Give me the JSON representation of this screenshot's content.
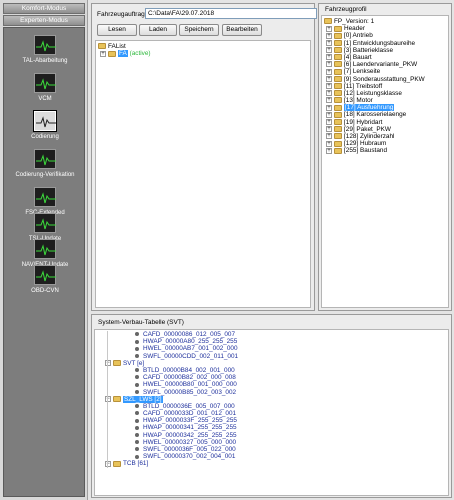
{
  "modes": {
    "komfort": "Komfort-Modus",
    "experten": "Experten-Modus"
  },
  "tools": [
    "TAL-Abarbeitung",
    "VCM",
    "Codierung",
    "Codierung-Verifikation",
    "FSC-Extended",
    "TSL-Update",
    "NAV/ENT-Update",
    "OBD-CVN"
  ],
  "auftrag": {
    "label": "Fahrzeugauftrag",
    "value": "C:\\Data\\FA\\29.07.2018",
    "buttons": [
      "Lesen",
      "Laden",
      "Speichern",
      "Bearbeiten"
    ],
    "tree_root": "FAList",
    "tree_child": "FA",
    "tree_child_suffix": "(active)"
  },
  "profil": {
    "title": "Fahrzeugprofil",
    "root": "FP_Version: 1",
    "items": [
      "Header",
      "[0] Antrieb",
      "[1] Entwicklungsbaureihe",
      "[3] Batterieklasse",
      "[4] Bauart",
      "[6] Laendervariante_PKW",
      "[7] Lenkseite",
      "[9] Sonderausstattung_PKW",
      "[11] Treibstoff",
      "[12] Leistungsklasse",
      "[13] Motor",
      "[17] Ausfuehrung",
      "[18] Karosserielaenge",
      "[19] Hybridart",
      "[29] Paket_PKW",
      "[128] Zylinderzahl",
      "[129] Hubraum",
      "[255] Baustand"
    ],
    "selected_index": 11
  },
  "svt": {
    "title": "System-Verbau-Tabelle (SVT)",
    "rows": [
      {
        "type": "leaf",
        "indent": 2,
        "text": "CAFD_00000086_012_005_007"
      },
      {
        "type": "leaf",
        "indent": 2,
        "text": "HWAP_00000A80_255_255_255"
      },
      {
        "type": "leaf",
        "indent": 2,
        "text": "HWEL_00000AB7_001_002_000"
      },
      {
        "type": "leaf",
        "indent": 2,
        "text": "SWFL_00000CDD_002_011_001"
      },
      {
        "type": "node",
        "indent": 1,
        "text": "SVT [e]"
      },
      {
        "type": "leaf",
        "indent": 2,
        "text": "BTLD_00000B84_002_001_000"
      },
      {
        "type": "leaf",
        "indent": 2,
        "text": "CAFD_00000B82_002_000_008"
      },
      {
        "type": "leaf",
        "indent": 2,
        "text": "HWEL_00000B80_001_000_000"
      },
      {
        "type": "leaf",
        "indent": 2,
        "text": "SWFL_00000B85_002_003_002"
      },
      {
        "type": "node",
        "indent": 1,
        "text": "SZL_LWS [2]",
        "selected": true
      },
      {
        "type": "leaf",
        "indent": 2,
        "text": "BTLD_0000036E_005_007_000"
      },
      {
        "type": "leaf",
        "indent": 2,
        "text": "CAFD_0000033D_001_012_001"
      },
      {
        "type": "leaf",
        "indent": 2,
        "text": "HWAP_0000033F_255_255_255"
      },
      {
        "type": "leaf",
        "indent": 2,
        "text": "HWAP_00000341_255_255_255"
      },
      {
        "type": "leaf",
        "indent": 2,
        "text": "HWAP_00000342_255_255_255"
      },
      {
        "type": "leaf",
        "indent": 2,
        "text": "HWEL_00000327_005_000_000"
      },
      {
        "type": "leaf",
        "indent": 2,
        "text": "SWFL_0000036F_005_022_000"
      },
      {
        "type": "leaf",
        "indent": 2,
        "text": "SWFL_00000370_002_004_001"
      },
      {
        "type": "node",
        "indent": 1,
        "text": "TCB [61]"
      }
    ]
  },
  "colors": {
    "selection": "#3399ff",
    "tree_text": "#1d2f9c",
    "active_text": "#2bb83a",
    "sidebar_panel": "#7d7d7d"
  }
}
